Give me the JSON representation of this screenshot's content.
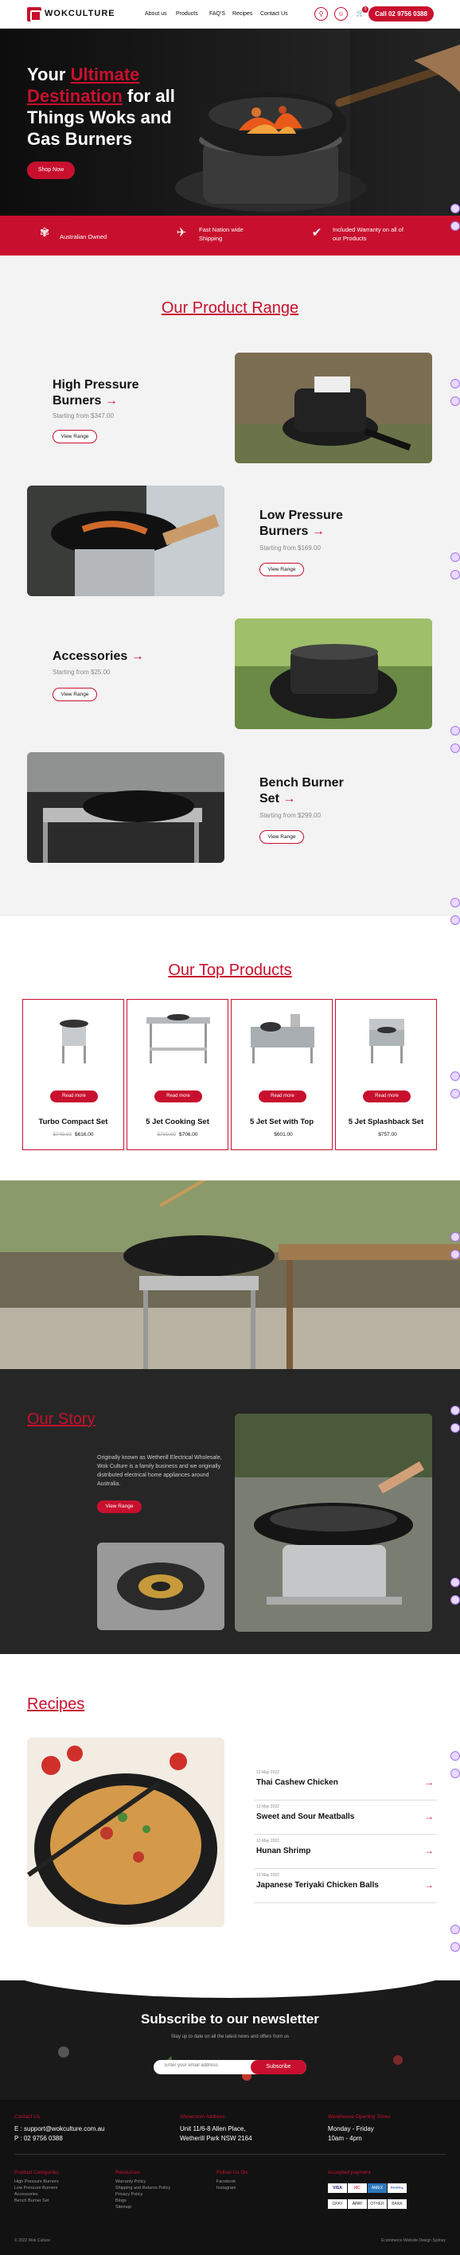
{
  "header": {
    "logo": "WOKCULTURE",
    "nav": [
      "About us",
      "Products",
      "FAQ'S",
      "Recipes",
      "Contact Us"
    ],
    "cart_count": "0",
    "call": "Call 02 9756 0388"
  },
  "hero": {
    "line1_pre": "Your",
    "line1_accent": "Ultimate",
    "line2_accent": "Destination",
    "line2_post": "for all",
    "line3": "Things Woks and",
    "line4": "Gas Burners",
    "cta": "Shop Now"
  },
  "band": {
    "items": [
      "Australian Owned",
      "Fast Nation wide Shipping",
      "Included Warranty on all of our Products"
    ]
  },
  "range": {
    "title": "Our Product Range",
    "products": [
      {
        "title": "High Pressure Burners",
        "sub": "Starting from $347.00",
        "btn": "View Range"
      },
      {
        "title": "Low Pressure Burners",
        "sub": "Starting from $169.00",
        "btn": "View Range"
      },
      {
        "title": "Accessories",
        "sub": "Starting from $25.00",
        "btn": "View Range"
      },
      {
        "title": "Bench Burner Set",
        "sub": "Starting from $299.00",
        "btn": "View Range"
      }
    ]
  },
  "top": {
    "title": "Our Top Products",
    "items": [
      {
        "name": "Turbo Compact Set",
        "old": "$749.00",
        "price": "$616.00",
        "btn": "Read more"
      },
      {
        "name": "5 Jet Cooking Set",
        "old": "$799.00",
        "price": "$706.00",
        "btn": "Read more"
      },
      {
        "name": "5 Jet Set with Top",
        "old": "",
        "price": "$601.00",
        "btn": "Read more"
      },
      {
        "name": "5 Jet Splashback Set",
        "old": "",
        "price": "$757.00",
        "btn": "Read more"
      }
    ]
  },
  "story": {
    "title": "Our Story",
    "text": "Originally known as Wetherill Electrical Wholesale, Wok Culture is a family business and we originally distributed electrical home appliances around Australia.",
    "btn": "View Range"
  },
  "recipes": {
    "title": "Recipes",
    "items": [
      {
        "date": "13 May 2022",
        "title": "Thai Cashew Chicken"
      },
      {
        "date": "13 May 2022",
        "title": "Sweet and Sour Meatballs"
      },
      {
        "date": "13 May 2022",
        "title": "Hunan Shrimp"
      },
      {
        "date": "13 May 2022",
        "title": "Japanese Teriyaki Chicken Balls"
      }
    ]
  },
  "newsletter": {
    "title": "Subscribe to our newsletter",
    "sub": "Stay up to date on all the latest news and offers from us",
    "placeholder": "Enter your email address",
    "btn": "Subscribe"
  },
  "footer": {
    "contact_h": "Contact Us",
    "email": "E : support@wokculture.com.au",
    "phone": "P : 02 9756 0388",
    "showroom_h": "Showroom Address",
    "addr1": "Unit 11/6-8 Allen Place,",
    "addr2": "Wetherill Park NSW 2164",
    "hours_h": "Warehouse Opening Times",
    "days": "Monday - Friday",
    "hours": "10am - 4pm",
    "cat_h": "Product Categories",
    "cats": [
      "High Pressure Burners",
      "Low Pressure Burners",
      "Accessories",
      "Bench Burner Set"
    ],
    "res_h": "Resources",
    "res": [
      "Warranty Policy",
      "Shipping and Returns Policy",
      "Privacy Policy",
      "Blogs",
      "Sitemap"
    ],
    "follow_h": "Follow Us On",
    "follow": [
      "Facebook",
      "Instagram"
    ],
    "pay_h": "Accepted payment",
    "pay": [
      "VISA",
      "MC",
      "AMEX",
      "PAYPAL",
      "GPAY",
      "APAY",
      "OTHER",
      "BANK"
    ],
    "copyright": "© 2022 Wok Culture",
    "credit": "Ecommerce Website Design Sydney"
  },
  "colors": {
    "accent": "#c8102e",
    "dark": "#262626"
  }
}
